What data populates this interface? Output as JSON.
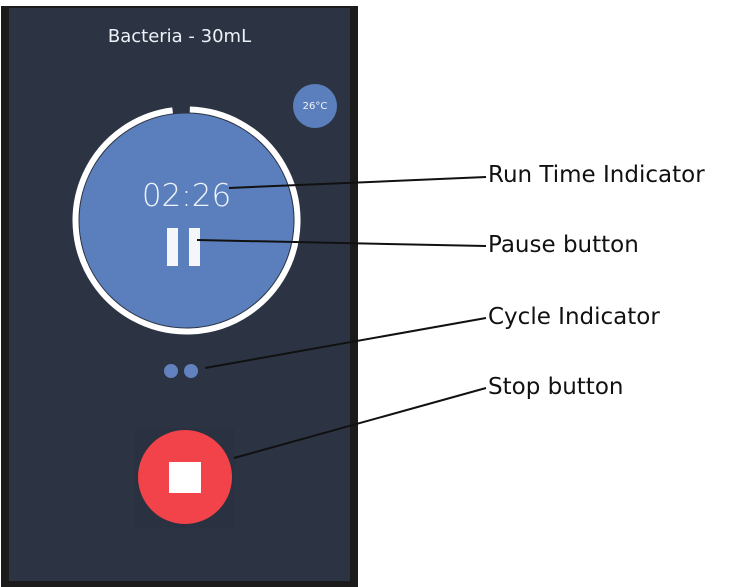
{
  "screen": {
    "title": "Bacteria - 30mL",
    "temperature": "26°C",
    "run_time": "02:26",
    "progress": 0.98,
    "cycles_count": 2
  },
  "callouts": {
    "run_time": "Run Time Indicator",
    "pause": "Pause button",
    "cycle": "Cycle Indicator",
    "stop": "Stop button"
  },
  "colors": {
    "screen_bg": "#2c3444",
    "accent_blue": "#5b7fbd",
    "stop_red": "#f2434a",
    "ring_white": "#ffffff"
  },
  "icons": [
    "pause-icon",
    "stop-icon"
  ]
}
